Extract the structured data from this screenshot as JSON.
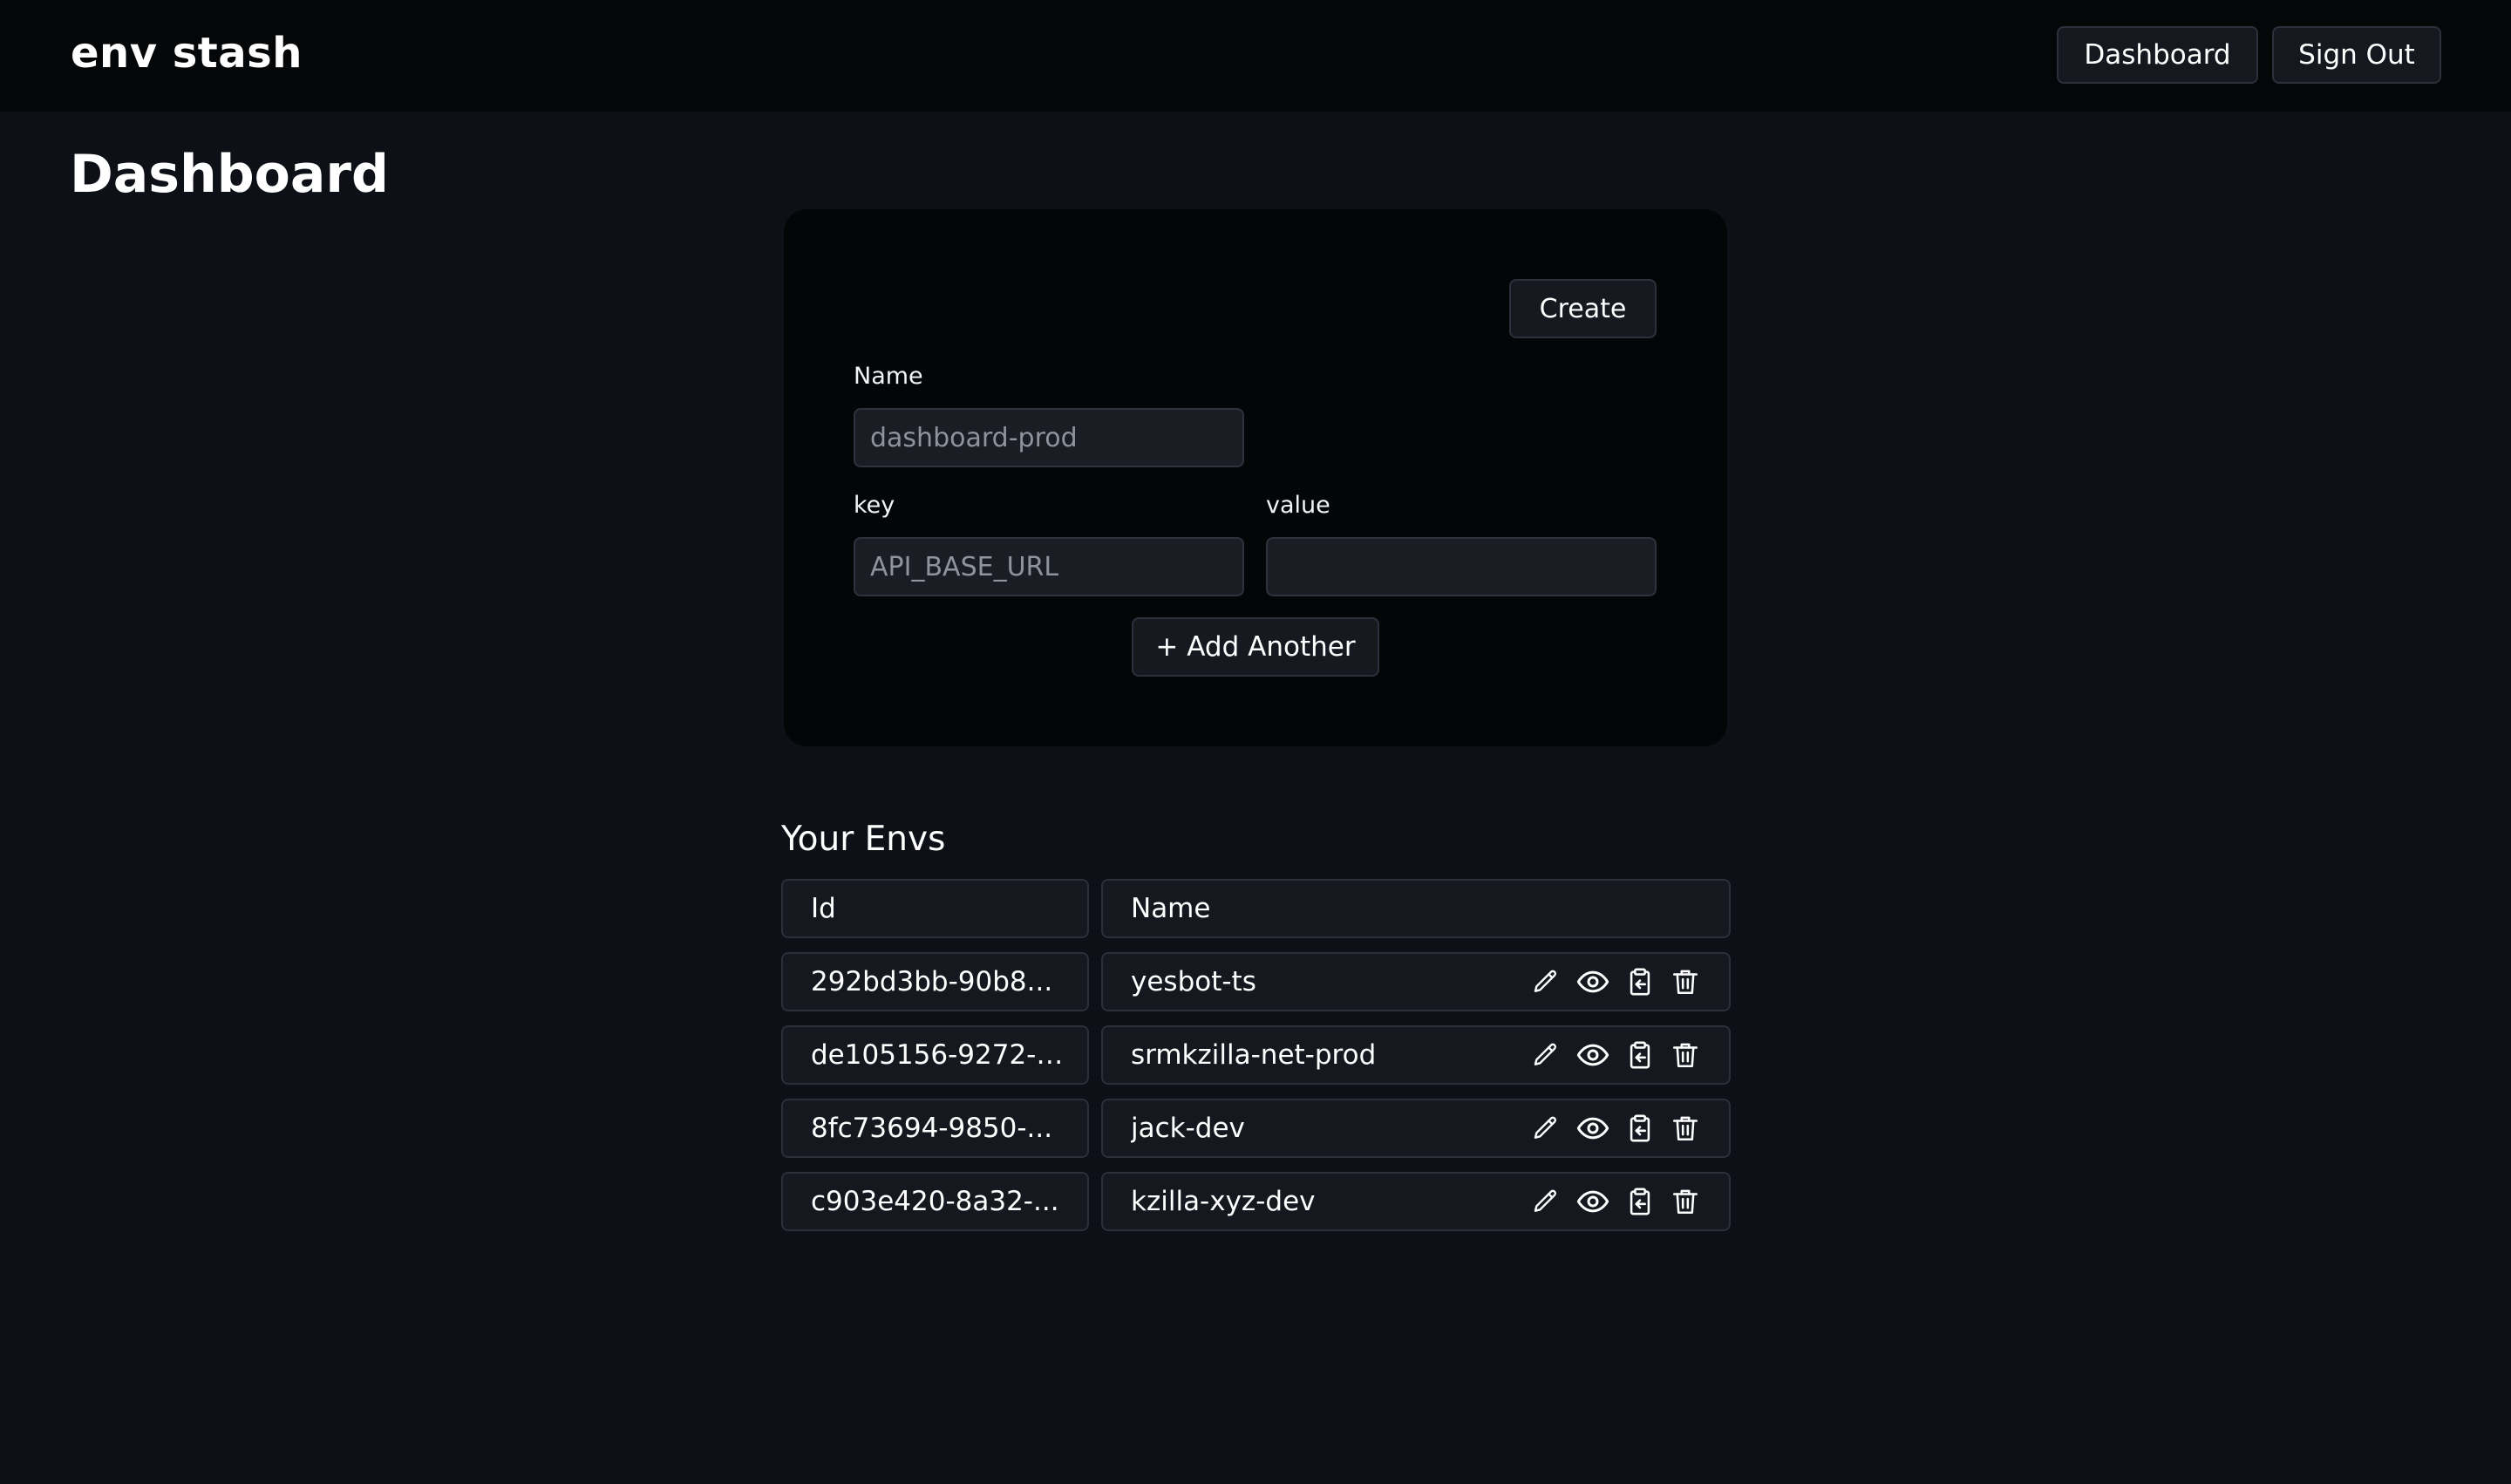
{
  "header": {
    "brand": "env stash",
    "nav_dashboard": "Dashboard",
    "nav_signout": "Sign Out"
  },
  "page": {
    "title": "Dashboard"
  },
  "form": {
    "create_label": "Create",
    "name_label": "Name",
    "name_placeholder": "dashboard-prod",
    "name_value": "",
    "key_label": "key",
    "key_placeholder": "API_BASE_URL",
    "key_value": "",
    "value_label": "value",
    "value_placeholder": "",
    "value_value": "",
    "add_another_label": "+ Add Another"
  },
  "envs": {
    "title": "Your Envs",
    "columns": [
      "Id",
      "Name"
    ],
    "rows": [
      {
        "id": "292bd3bb-90b8...",
        "name": "yesbot-ts"
      },
      {
        "id": "de105156-9272-4...",
        "name": "srmkzilla-net-prod"
      },
      {
        "id": "8fc73694-9850-...",
        "name": "jack-dev"
      },
      {
        "id": "c903e420-8a32-...",
        "name": "kzilla-xyz-dev"
      }
    ],
    "row_actions": [
      "pencil-icon",
      "eye-icon",
      "clipboard-copy-icon",
      "trash-icon"
    ]
  },
  "colors": {
    "background": "#0d1016",
    "header": "#050608",
    "card": "#040507",
    "input_bg": "#1a1d24",
    "border": "#2b303a",
    "text": "#ffffff",
    "placeholder": "#8e939c"
  }
}
